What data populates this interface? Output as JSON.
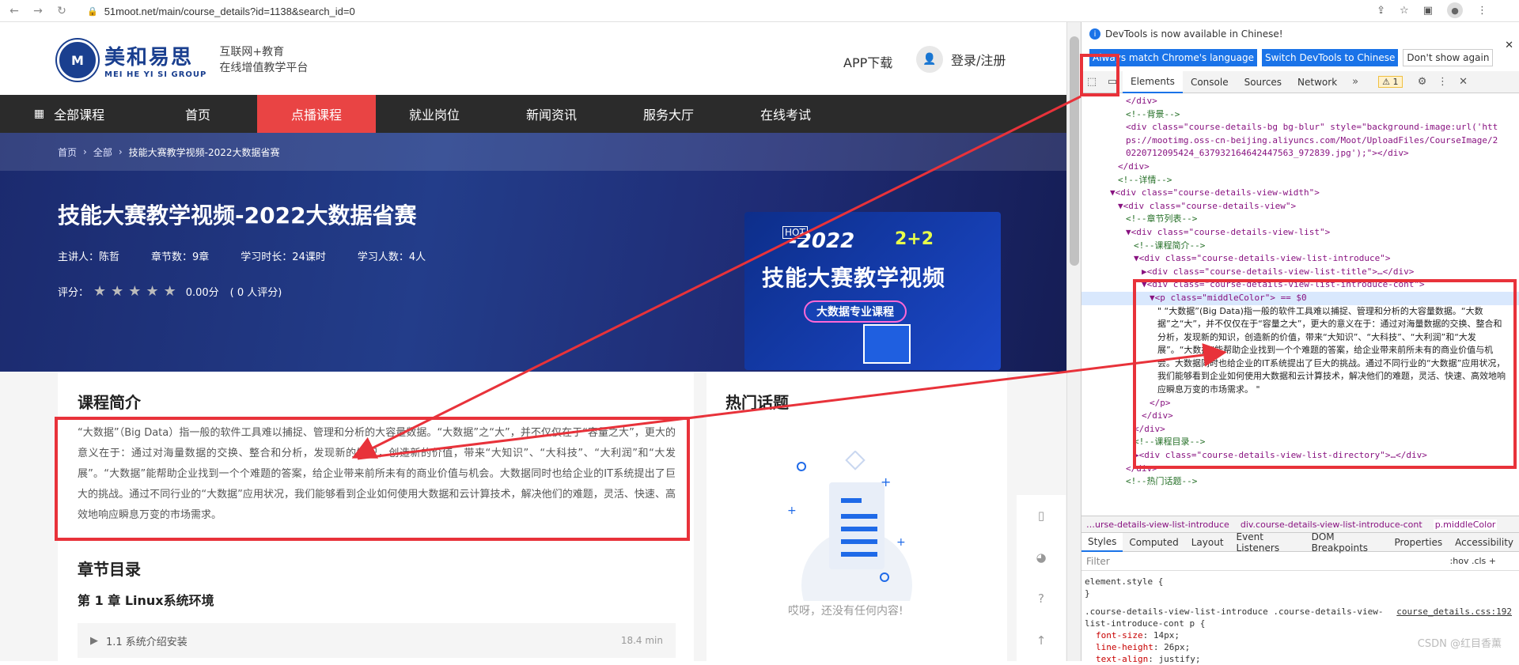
{
  "browser": {
    "url": "51moot.net/main/course_details?id=1138&search_id=0"
  },
  "site": {
    "logo_cn": "美和易思",
    "logo_en": "MEI HE YI SI GROUP",
    "slogan_line1": "互联网+教育",
    "slogan_line2": "在线增值教学平台",
    "app_download": "APP下载",
    "login": "登录/注册"
  },
  "menu": {
    "items": [
      {
        "label": "全部课程"
      },
      {
        "label": "首页"
      },
      {
        "label": "点播课程"
      },
      {
        "label": "就业岗位"
      },
      {
        "label": "新闻资讯"
      },
      {
        "label": "服务大厅"
      },
      {
        "label": "在线考试"
      }
    ]
  },
  "breadcrumb": {
    "home": "首页",
    "all": "全部",
    "current": "技能大赛教学视频-2022大数据省赛"
  },
  "course": {
    "title": "技能大赛教学视频-2022大数据省赛",
    "lecturer": "主讲人：陈哲",
    "chapters": "章节数：9章",
    "duration": "学习时长：24课时",
    "learners": "学习人数：4人",
    "rating_label": "评分：",
    "rating_value": "0.00分",
    "rating_count": "( 0 人评分)",
    "stars": 0,
    "cover_hot": "HOT",
    "cover_year": "-2022",
    "cover_pp": "2+2",
    "cover_big": "技能大赛教学视频",
    "cover_pill": "大数据专业课程"
  },
  "intro": {
    "title": "课程简介",
    "text": "“大数据”（Big Data）指一般的软件工具难以捕捉、管理和分析的大容量数据。“大数据”之“大”，并不仅仅在于“容量之大”，更大的意义在于：通过对海量数据的交换、整合和分析，发现新的知识，创造新的价值，带来“大知识”、“大科技”、“大利润”和“大发展”。“大数据”能帮助企业找到一个个难题的答案，给企业带来前所未有的商业价值与机会。大数据同时也给企业的IT系统提出了巨大的挑战。通过不同行业的“大数据”应用状况，我们能够看到企业如何使用大数据和云计算技术，解决他们的难题，灵活、快速、高效地响应瞬息万变的市场需求。"
  },
  "chapters": {
    "title": "章节目录",
    "chapter1": "第 1 章 Linux系统环境",
    "lesson1": "1.1 系统介绍安装",
    "lesson1_dur": "18.4 min"
  },
  "hot": {
    "title": "热门话题",
    "empty": "哎呀，还没有任何内容!"
  },
  "devtools": {
    "notice": "DevTools is now available in Chinese!",
    "btn_match": "Always match Chrome's language",
    "btn_switch": "Switch DevTools to Chinese",
    "btn_dont": "Don't show again",
    "tabs": [
      "Elements",
      "Console",
      "Sources",
      "Network"
    ],
    "warn_count": "1",
    "dom_lines": [
      {
        "indent": 5,
        "html": "</div>"
      },
      {
        "indent": 5,
        "html": "<!--背景-->"
      },
      {
        "indent": 5,
        "html": "<div class=\"course-details-bg bg-blur\" style=\"background-image:url('htt"
      },
      {
        "indent": 5,
        "html": "ps://mootimg.oss-cn-beijing.aliyuncs.com/Moot/UploadFiles/CourseImage/2"
      },
      {
        "indent": 5,
        "html": "0220712095424_637932164642447563_972839.jpg');\"></div>"
      },
      {
        "indent": 4,
        "html": "</div>"
      },
      {
        "indent": 4,
        "html": "<!--详情-->"
      },
      {
        "indent": 3,
        "html": "▼<div class=\"course-details-view-width\">"
      },
      {
        "indent": 4,
        "html": "▼<div class=\"course-details-view\">"
      },
      {
        "indent": 5,
        "html": "<!--章节列表-->"
      },
      {
        "indent": 5,
        "html": "▼<div class=\"course-details-view-list\">"
      },
      {
        "indent": 6,
        "html": "<!--课程简介-->"
      },
      {
        "indent": 6,
        "html": "▼<div class=\"course-details-view-list-introduce\">"
      },
      {
        "indent": 7,
        "html": "▶<div class=\"course-details-view-list-title\">…</div>"
      },
      {
        "indent": 7,
        "html": "▼<div class=\"course-details-view-list-introduce-cont\">"
      },
      {
        "indent": 8,
        "html": "▼<p class=\"middleColor\"> == $0"
      }
    ],
    "dom_text": "\" “大数据”(Big Data)指一般的软件工具难以捕捉、管理和分析的大容量数据。“大数据”之“大”，并不仅仅在于“容量之大”，更大的意义在于：通过对海量数据的交换、整合和分析，发现新的知识，创造新的价值，带来“大知识”、“大科技”、“大利润”和“大发展”。“大数据”能帮助企业找到一个个难题的答案，给企业带来前所未有的商业价值与机会。大数据同时也给企业的IT系统提出了巨大的挑战。通过不同行业的“大数据”应用状况，我们能够看到企业如何使用大数据和云计算技术，解决他们的难题，灵活、快速、高效地响应瞬息万变的市场需求。 \"",
    "dom_tail": [
      {
        "indent": 8,
        "html": "</p>"
      },
      {
        "indent": 7,
        "html": "</div>"
      },
      {
        "indent": 6,
        "html": "</div>"
      },
      {
        "indent": 6,
        "html": "<!--课程目录-->"
      },
      {
        "indent": 6,
        "html": "▶<div class=\"course-details-view-list-directory\">…</div>"
      },
      {
        "indent": 5,
        "html": "</div>"
      },
      {
        "indent": 5,
        "html": "<!--热门话题-->"
      }
    ],
    "crumbs": [
      "…urse-details-view-list-introduce",
      "div.course-details-view-list-introduce-cont",
      "p.middleColor"
    ],
    "subtabs": [
      "Styles",
      "Computed",
      "Layout",
      "Event Listeners",
      "DOM Breakpoints",
      "Properties",
      "Accessibility"
    ],
    "filter_placeholder": "Filter",
    "filter_right": ":hov  .cls  +",
    "element_style": "element.style {",
    "element_style_close": "}",
    "rule_selector": ".course-details-view-list-introduce .course-details-view-list-introduce-cont p {",
    "rule_link": "course_details.css:192",
    "rule_props": [
      {
        "name": "font-size",
        "value": "14px;"
      },
      {
        "name": "line-height",
        "value": "26px;"
      },
      {
        "name": "text-align",
        "value": "justify;"
      }
    ]
  },
  "watermark": "CSDN @红目香薰"
}
